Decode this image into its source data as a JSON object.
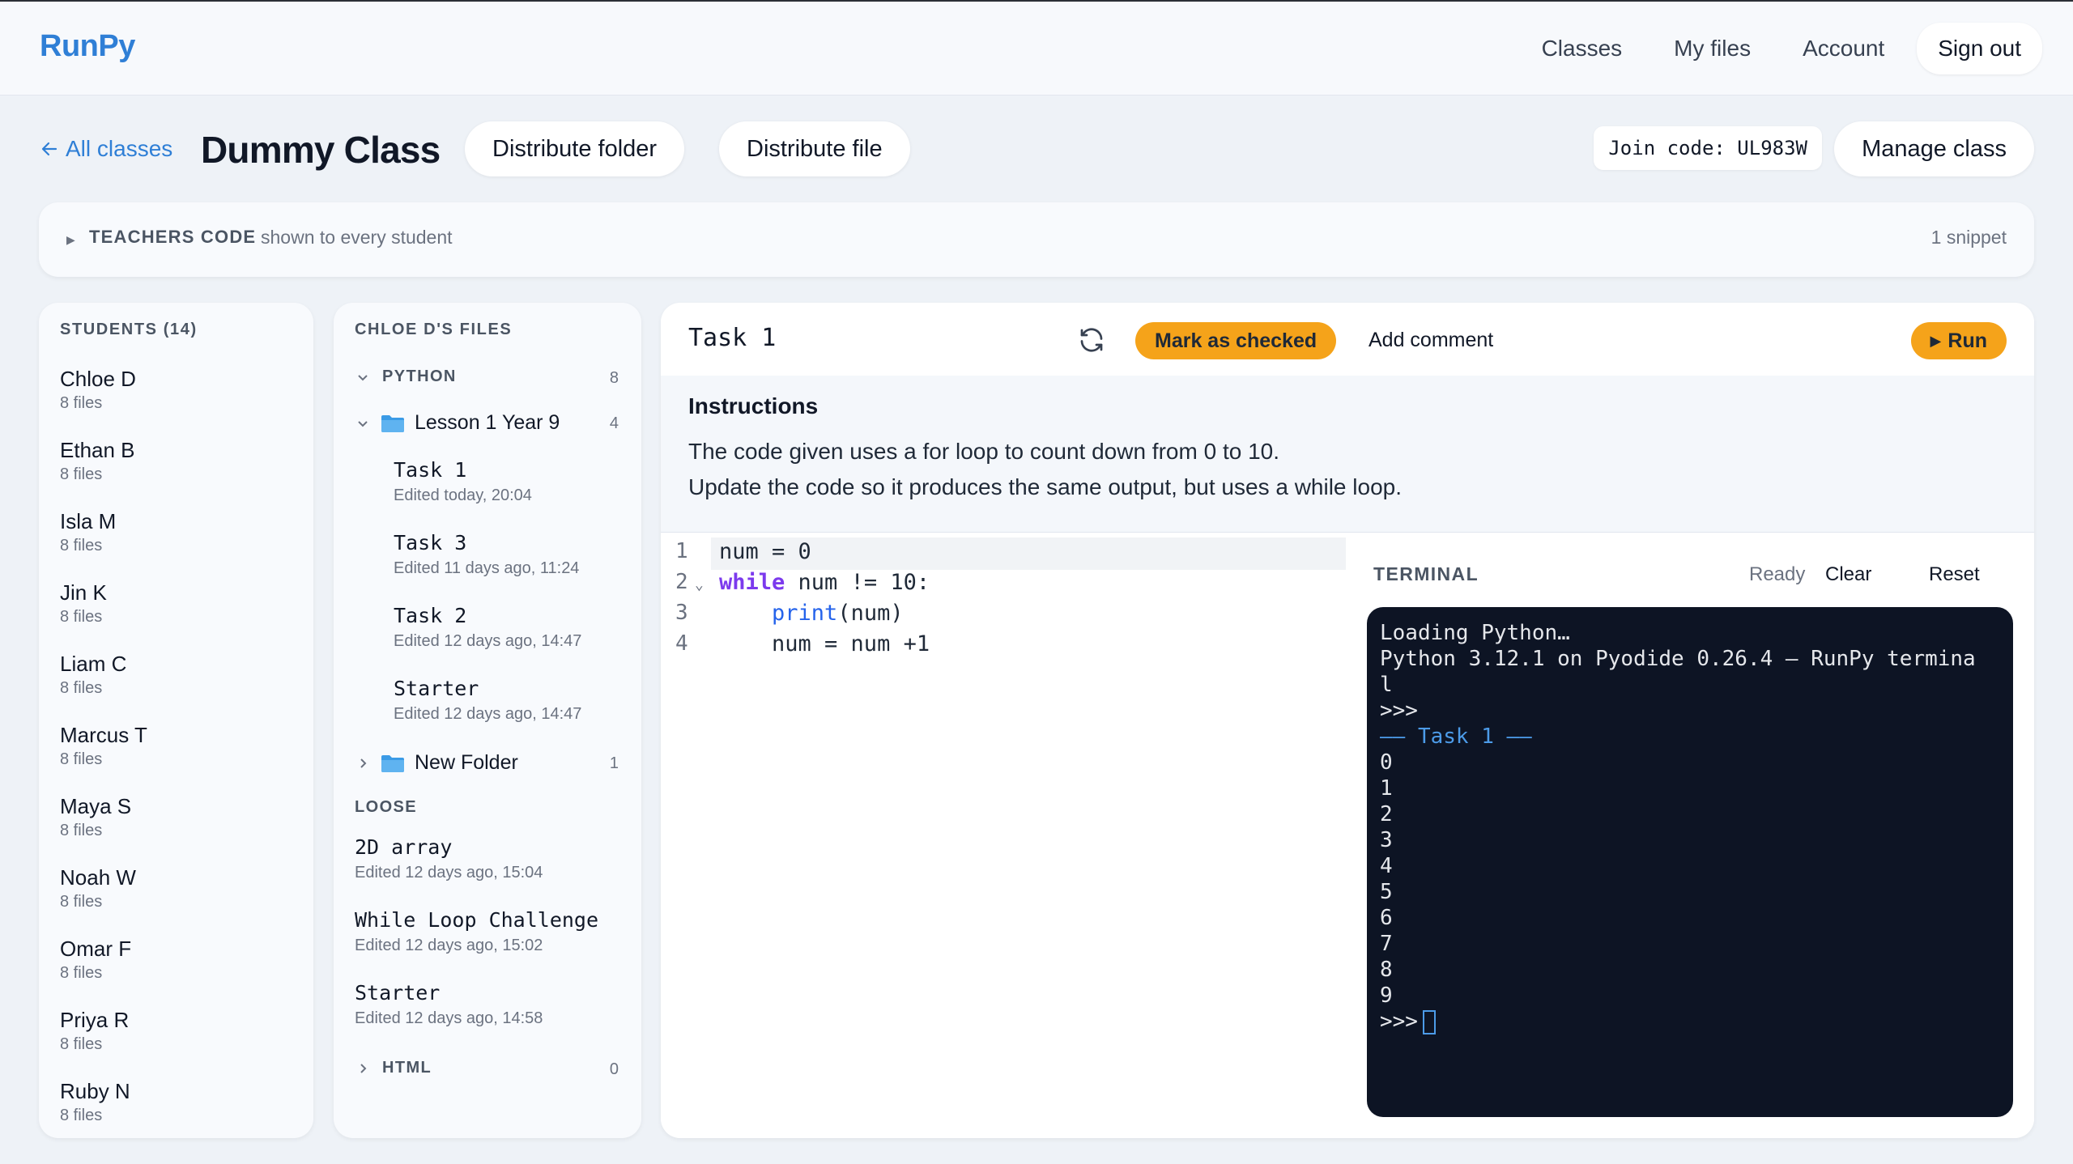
{
  "app": {
    "logo": "RunPy"
  },
  "nav": {
    "classes": "Classes",
    "my_files": "My files",
    "account": "Account",
    "sign_out": "Sign out"
  },
  "classbar": {
    "back": "All classes",
    "title": "Dummy Class",
    "distribute_folder": "Distribute folder",
    "distribute_file": "Distribute file",
    "join_code": "Join code: UL983W",
    "manage": "Manage class"
  },
  "teachers_code": {
    "label": "TEACHERS CODE",
    "subtitle": "shown to every student",
    "count": "1 snippet"
  },
  "students": {
    "heading": "STUDENTS (14)",
    "items": [
      {
        "name": "Chloe D",
        "files": "8 files"
      },
      {
        "name": "Ethan B",
        "files": "8 files"
      },
      {
        "name": "Isla M",
        "files": "8 files"
      },
      {
        "name": "Jin K",
        "files": "8 files"
      },
      {
        "name": "Liam C",
        "files": "8 files"
      },
      {
        "name": "Marcus T",
        "files": "8 files"
      },
      {
        "name": "Maya S",
        "files": "8 files"
      },
      {
        "name": "Noah W",
        "files": "8 files"
      },
      {
        "name": "Omar F",
        "files": "8 files"
      },
      {
        "name": "Priya R",
        "files": "8 files"
      },
      {
        "name": "Ruby N",
        "files": "8 files"
      }
    ]
  },
  "files": {
    "heading": "CHLOE D'S FILES",
    "python": {
      "label": "PYTHON",
      "count": "8"
    },
    "lesson": {
      "label": "Lesson 1 Year 9",
      "count": "4"
    },
    "lesson_files": [
      {
        "name": "Task 1",
        "meta": "Edited today, 20:04"
      },
      {
        "name": "Task 3",
        "meta": "Edited 11 days ago, 11:24"
      },
      {
        "name": "Task 2",
        "meta": "Edited 12 days ago, 14:47"
      },
      {
        "name": "Starter",
        "meta": "Edited 12 days ago, 14:47"
      }
    ],
    "new_folder": {
      "label": "New Folder",
      "count": "1"
    },
    "loose": {
      "label": "LOOSE"
    },
    "loose_files": [
      {
        "name": "2D array",
        "meta": "Edited 12 days ago, 15:04"
      },
      {
        "name": "While Loop Challenge",
        "meta": "Edited 12 days ago, 15:02"
      },
      {
        "name": "Starter",
        "meta": "Edited 12 days ago, 14:58"
      }
    ],
    "html": {
      "label": "HTML",
      "count": "0"
    }
  },
  "editor": {
    "task_title": "Task 1",
    "mark_checked": "Mark as checked",
    "add_comment": "Add comment",
    "run": "Run",
    "instructions_title": "Instructions",
    "instructions": [
      "The code given uses a for loop to count down from 0 to 10.",
      "Update the code so it produces the same output, but uses a while loop."
    ],
    "line_numbers": [
      "1",
      "2",
      "3",
      "4"
    ],
    "code": {
      "l1": "num = 0",
      "l2_kw": "while",
      "l2_rest": " num != 10:",
      "l3_indent": "    ",
      "l3_fn": "print",
      "l3_rest": "(num)",
      "l4": "    num = num +1"
    }
  },
  "terminal": {
    "label": "TERMINAL",
    "status": "Ready",
    "clear": "Clear",
    "reset": "Reset",
    "lines": [
      "Loading Python…",
      "Python 3.12.1 on Pyodide 0.26.4 — RunPy termina",
      "l",
      ">>>"
    ],
    "banner": "—— Task 1 ——",
    "output": [
      "0",
      "1",
      "2",
      "3",
      "4",
      "5",
      "6",
      "7",
      "8",
      "9"
    ],
    "prompt": ">>>"
  },
  "colors": {
    "accent": "#2f7fd6",
    "button_orange": "#f5a31a",
    "terminal_bg": "#0d1424"
  }
}
